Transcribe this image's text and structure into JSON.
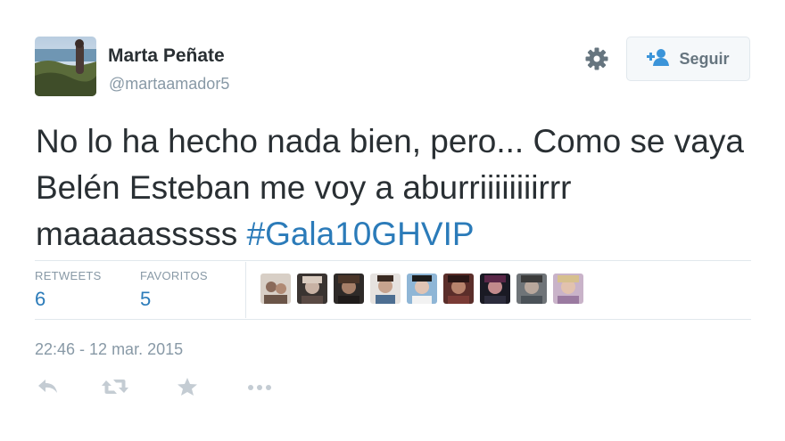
{
  "user": {
    "name": "Marta Peñate",
    "handle": "@martaamador5"
  },
  "follow_button": {
    "label": "Seguir"
  },
  "tweet": {
    "text_before_hashtag": "No lo ha hecho nada bien, pero... Como se vaya Belén Esteban me voy a aburriiiiiiiirrr maaaaasssss ",
    "hashtag": "#Gala10GHVIP"
  },
  "stats": {
    "retweets_label": "RETWEETS",
    "retweets_count": "6",
    "favorites_label": "FAVORITOS",
    "favorites_count": "5"
  },
  "favoriters": [
    {
      "icon": "avatar-icon"
    },
    {
      "icon": "avatar-icon"
    },
    {
      "icon": "avatar-icon"
    },
    {
      "icon": "avatar-icon"
    },
    {
      "icon": "avatar-icon"
    },
    {
      "icon": "avatar-icon"
    },
    {
      "icon": "avatar-icon"
    },
    {
      "icon": "avatar-icon"
    },
    {
      "icon": "avatar-icon"
    }
  ],
  "timestamp": "22:46 - 12 mar. 2015",
  "actions": [
    "reply-icon",
    "retweet-icon",
    "favorite-star-icon",
    "more-dots-icon"
  ],
  "colors": {
    "link": "#2b7bb9",
    "muted": "#8899a6",
    "text": "#292f33",
    "action_icon": "#c4ccd3"
  }
}
